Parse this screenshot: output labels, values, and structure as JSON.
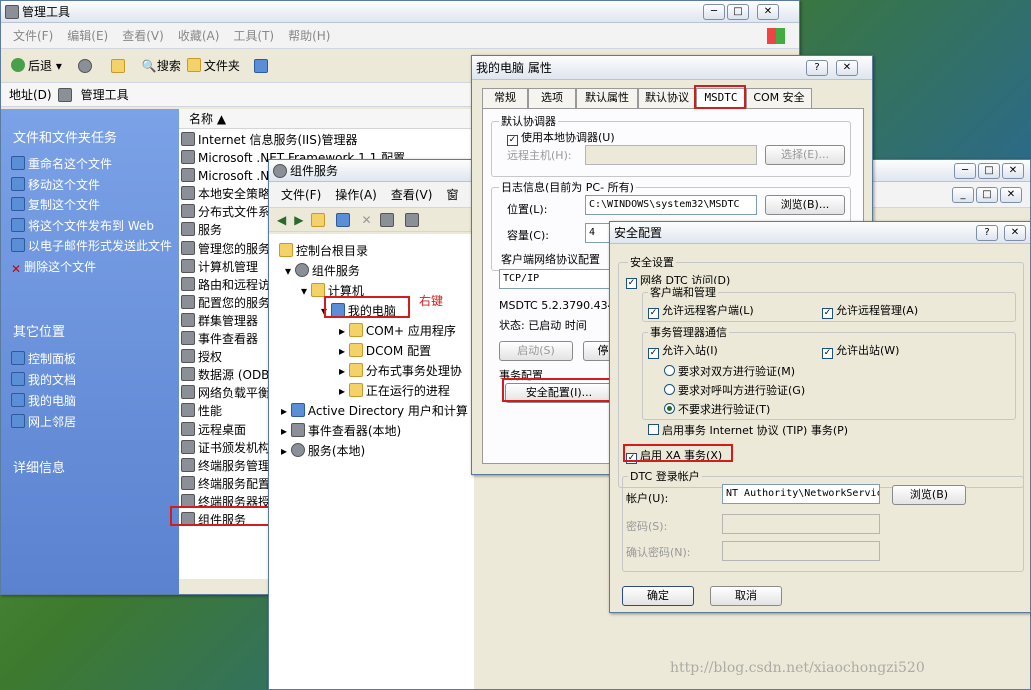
{
  "explorer": {
    "title": "管理工具",
    "menu": [
      "文件(F)",
      "编辑(E)",
      "查看(V)",
      "收藏(A)",
      "工具(T)",
      "帮助(H)"
    ],
    "toolbar": {
      "back": "后退",
      "search": "搜索",
      "folders": "文件夹"
    },
    "address_label": "地址(D)",
    "address_value": "管理工具",
    "task_header": "文件和文件夹任务",
    "tasks": [
      "重命名这个文件",
      "移动这个文件",
      "复制这个文件",
      "将这个文件发布到 Web",
      "以电子邮件形式发送此文件",
      "删除这个文件"
    ],
    "places_header": "其它位置",
    "places": [
      "控制面板",
      "我的文档",
      "我的电脑",
      "网上邻居"
    ],
    "details_header": "详细信息",
    "col_name": "名称",
    "files": [
      "Internet 信息服务(IIS)管理器",
      "Microsoft .NET Framework 1.1 配置",
      "Microsoft .N",
      "本地安全策略",
      "分布式文件系",
      "服务",
      "管理您的服务",
      "计算机管理",
      "路由和远程访",
      "配置您的服务",
      "群集管理器",
      "事件查看器",
      "授权",
      "数据源 (ODBC",
      "网络负载平衡",
      "性能",
      "远程桌面",
      "证书颁发机构",
      "终端服务管理",
      "终端服务配置",
      "终端服务器授",
      "组件服务"
    ]
  },
  "compsvc": {
    "title": "组件服务",
    "menu": [
      "文件(F)",
      "操作(A)",
      "查看(V)",
      "窗"
    ],
    "tree": {
      "root": "控制台根目录",
      "services": "组件服务",
      "computers": "计算机",
      "mypc": "我的电脑",
      "com": "COM+ 应用程序",
      "dcom": "DCOM 配置",
      "dtc": "分布式事务处理协",
      "running": "正在运行的进程",
      "ad": "Active Directory 用户和计算",
      "events": "事件查看器(本地)",
      "svc": "服务(本地)"
    },
    "annotation": "右键"
  },
  "props": {
    "title": "我的电脑 属性",
    "tabs": [
      "常规",
      "选项",
      "默认属性",
      "默认协议",
      "MSDTC",
      "COM 安全"
    ],
    "default_coord": "默认协调器",
    "use_local": "使用本地协调器(U)",
    "remote_host": "远程主机(H):",
    "select_btn": "选择(E)...",
    "log_header": "日志信息(目前为 PC- 所有)",
    "location_label": "位置(L):",
    "location_value": "C:\\WINDOWS\\system32\\MSDTC",
    "browse_btn": "浏览(B)...",
    "capacity_label": "容量(C):",
    "capacity_value": "4",
    "client_proto": "客户端网络协议配置",
    "proto_value": "TCP/IP",
    "version": "MSDTC 5.2.3790.434",
    "status": "状态: 已启动 时间",
    "start_btn": "启动(S)",
    "stop_btn": "停",
    "tx_config": "事务配置",
    "security_btn": "安全配置(I)..."
  },
  "security": {
    "title": "安全配置",
    "help": "?",
    "settings": "安全设置",
    "net_dtc": "网络 DTC 访问(D)",
    "client_admin": "客户端和管理",
    "allow_remote_client": "允许远程客户端(L)",
    "allow_remote_admin": "允许远程管理(A)",
    "tm_comm": "事务管理器通信",
    "allow_in": "允许入站(I)",
    "allow_out": "允许出站(W)",
    "mutual": "要求对双方进行验证(M)",
    "caller": "要求对呼叫方进行验证(G)",
    "none": "不要求进行验证(T)",
    "tip": "启用事务 Internet 协议 (TIP) 事务(P)",
    "xa": "启用 XA 事务(X)",
    "dtc_logon": "DTC 登录帐户",
    "account_label": "帐户(U):",
    "account_value": "NT Authority\\NetworkService",
    "browse_btn": "浏览(B)",
    "password_label": "密码(S):",
    "confirm_label": "确认密码(N):",
    "ok": "确定",
    "cancel": "取消"
  },
  "watermark": "http://blog.csdn.net/xiaochongzi520"
}
